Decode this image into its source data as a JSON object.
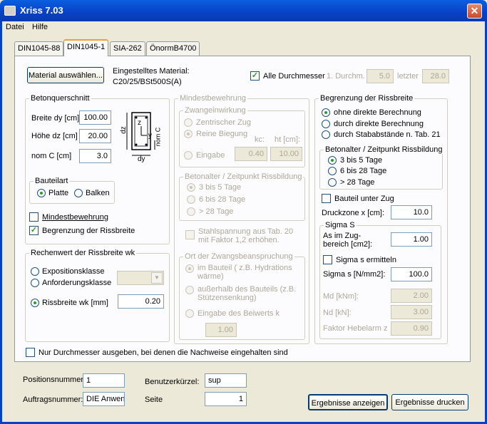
{
  "window": {
    "title": "Xriss 7.03",
    "close_glyph": "✕"
  },
  "menu": [
    "Datei",
    "Hilfe"
  ],
  "tabs": [
    "DIN1045-88",
    "DIN1045-1",
    "SIA-262",
    "ÖnormB4700"
  ],
  "material": {
    "button": "Material auswählen...",
    "current_label": "Eingestelltes Material:",
    "current_value": "C20/25/BSt500S(A)"
  },
  "diameters": {
    "all_label": "Alle Durchmesser",
    "all_checked": true,
    "first_label": "1. Durchm.",
    "first_value": "5.0",
    "last_label": "letzter",
    "last_value": "28.0"
  },
  "section": {
    "title": "Betonquerschnitt",
    "breite_label": "Breite dy [cm]",
    "breite_value": "100.00",
    "hoehe_label": "Höhe dz [cm]",
    "hoehe_value": "20.00",
    "nomc_label": "nom C [cm]",
    "nomc_value": "3.0",
    "diagram": {
      "dz": "dz",
      "dy": "dy",
      "z": "z",
      "y": "y",
      "nomc": "nom C"
    }
  },
  "bauteilart": {
    "title": "Bauteilart",
    "platte": "Platte",
    "balken": "Balken",
    "selected": "Platte"
  },
  "checks": {
    "mindest": "Mindestbewehrung",
    "mindest_checked": false,
    "begrenzung": "Begrenzung der Rissbreite",
    "begrenzung_checked": true
  },
  "wk": {
    "title": "Rechenwert der Rissbreite wk",
    "exposition": "Expositionsklasse",
    "anforderung": "Anforderungsklasse",
    "rissbreite": "Rissbreite wk [mm]",
    "rissbreite_value": "0.20",
    "selected": "Rissbreite wk [mm]"
  },
  "mindest_group": {
    "title": "Mindestbewehrung",
    "zwang": {
      "title": "Zwangeinwirkung",
      "zentrisch": "Zentrischer Zug",
      "reine": "Reine Biegung",
      "eingabe": "Eingabe",
      "kc_label": "kc:",
      "ht_label": "ht [cm]:",
      "kc_value": "0.40",
      "ht_value": "10.00"
    },
    "alter": {
      "title": "Betonalter / Zeitpunkt Rissbildung",
      "opt1": "3 bis 5 Tage",
      "opt2": "6 bis 28 Tage",
      "opt3": "> 28 Tage"
    },
    "stahl_label": "Stahlspannung aus Tab. 20 mit Faktor 1,2 erhöhen.",
    "ort": {
      "title": "Ort der Zwangsbeanspruchung",
      "opt1": "im Bauteil ( z.B. Hydrations wärme)",
      "opt2": "außerhalb des Bauteils (z.B. Stützensenkung)",
      "opt3": "Eingabe des Beiwerts k",
      "k_value": "1.00"
    }
  },
  "begr": {
    "title": "Begrenzung der Rissbreite",
    "opt1": "ohne direkte Berechnung",
    "opt2": "durch direkte Berechnung",
    "opt3": "durch Stababstände n. Tab. 21",
    "alter": {
      "title": "Betonalter / Zeitpunkt Rissbildung",
      "opt1": "3 bis 5 Tage",
      "opt2": "6 bis 28 Tage",
      "opt3": "> 28 Tage"
    },
    "unter_zug": "Bauteil unter Zug",
    "druckzone_label": "Druckzone x [cm]:",
    "druckzone_value": "10.0"
  },
  "sigma": {
    "title": "Sigma S",
    "as_label": "As im Zug- bereich [cm2]:",
    "as_value": "1.00",
    "ermitteln": "Sigma s ermitteln",
    "sigma_label": "Sigma s [N/mm2]:",
    "sigma_value": "100.0",
    "md_label": "Md [kNm]:",
    "md_value": "2.00",
    "nd_label": "Nd [kN]:",
    "nd_value": "3.00",
    "faktor_label": "Faktor Hebelarm z",
    "faktor_value": "0.90"
  },
  "nur_durchmesser": "Nur Durchmesser ausgeben, bei denen die Nachweise eingehalten sind",
  "footer": {
    "pos_label": "Positionsnummer:",
    "pos_value": "1",
    "auftrag_label": "Auftragsnummer:",
    "auftrag_value": "DIE Anwen",
    "user_label": "Benutzerkürzel:",
    "user_value": "sup",
    "seite_label": "Seite",
    "seite_value": "1",
    "anzeigen": "Ergebnisse anzeigen",
    "drucken": "Ergebnisse drucken"
  }
}
